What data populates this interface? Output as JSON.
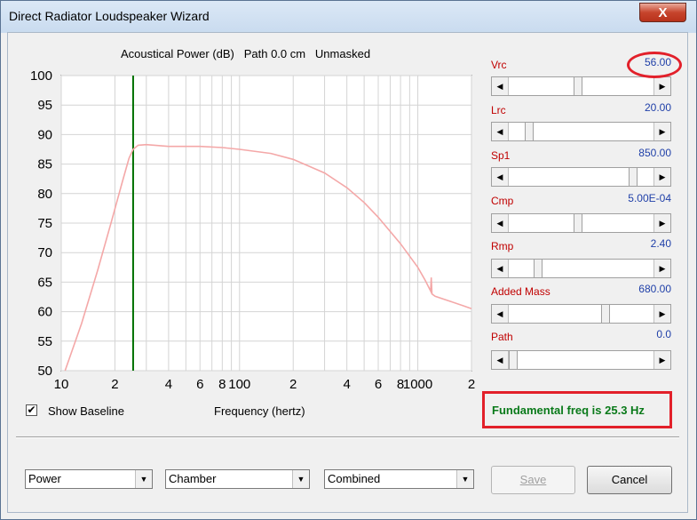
{
  "window": {
    "title": "Direct Radiator Loudspeaker Wizard",
    "close_label": "X"
  },
  "chart_title": "Acoustical Power (dB)   Path 0.0 cm   Unmasked",
  "chart_data": {
    "type": "line",
    "title": "Acoustical Power (dB)   Path 0.0 cm   Unmasked",
    "xlabel": "Frequency (hertz)",
    "ylabel": "",
    "x_scale": "log",
    "xlim": [
      10,
      2000
    ],
    "ylim": [
      50,
      100
    ],
    "x_tick_labels": [
      "10",
      "2",
      "4",
      "6",
      "8",
      "100",
      "2",
      "4",
      "6",
      "8",
      "1000",
      "2"
    ],
    "x_tick_values": [
      10,
      20,
      40,
      60,
      80,
      100,
      200,
      400,
      600,
      800,
      1000,
      2000
    ],
    "y_ticks": [
      50,
      55,
      60,
      65,
      70,
      75,
      80,
      85,
      90,
      95,
      100
    ],
    "grid": true,
    "marker_line_x": 25.3,
    "series": [
      {
        "color": "#f4a8a8",
        "x": [
          10.5,
          13,
          16,
          19,
          22,
          24,
          25.3,
          27,
          30,
          40,
          60,
          80,
          100,
          150,
          200,
          300,
          400,
          500,
          600,
          800,
          1000,
          1100,
          1180,
          1190,
          1200,
          1250,
          1500,
          1800,
          2000
        ],
        "y": [
          50,
          58,
          67,
          75,
          82,
          86,
          87.5,
          88.2,
          88.3,
          88.0,
          88.0,
          87.8,
          87.5,
          86.8,
          85.8,
          83.5,
          81.0,
          78.5,
          76.0,
          71.5,
          67.5,
          65.3,
          63.5,
          65.8,
          63.0,
          62.6,
          61.8,
          61.0,
          60.5
        ]
      }
    ],
    "colors": {
      "curve": "#f4a8a8",
      "marker_line": "#007000",
      "grid": "#d4d4d4"
    }
  },
  "params": [
    {
      "label": "Vrc",
      "value": "56.00",
      "thumb": 0.48
    },
    {
      "label": "Lrc",
      "value": "20.00",
      "thumb": 0.12
    },
    {
      "label": "Sp1",
      "value": "850.00",
      "thumb": 0.88
    },
    {
      "label": "Cmp",
      "value": "5.00E-04",
      "thumb": 0.48
    },
    {
      "label": "Rmp",
      "value": "2.40",
      "thumb": 0.18
    },
    {
      "label": "Added Mass",
      "value": "680.00",
      "thumb": 0.68
    },
    {
      "label": "Path",
      "value": "0.0",
      "thumb": 0.0
    }
  ],
  "show_baseline": {
    "label": "Show Baseline",
    "checked": true
  },
  "freq_axis_label": "Frequency (hertz)",
  "fundamental_text": "Fundamental freq is 25.3 Hz",
  "selects": [
    {
      "value": "Power"
    },
    {
      "value": "Chamber"
    },
    {
      "value": "Combined"
    }
  ],
  "buttons": {
    "save": "Save",
    "cancel": "Cancel"
  },
  "colors": {
    "param_label": "#c00000",
    "param_value": "#1f3fa8",
    "fundamental": "#0a7a1a",
    "annotation_red": "#e2202a"
  }
}
